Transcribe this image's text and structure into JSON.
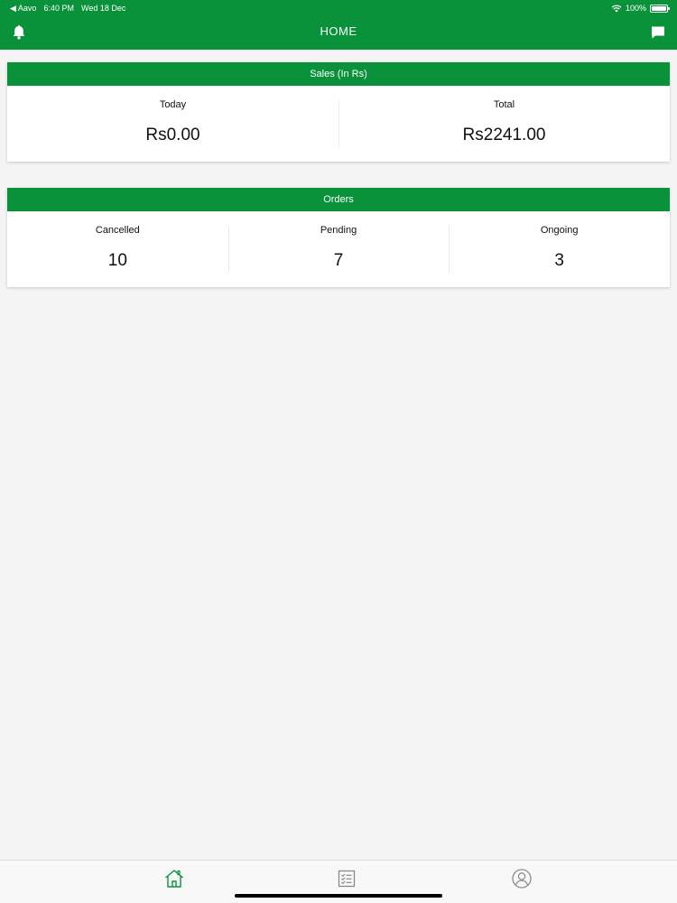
{
  "status_bar": {
    "back_label": "◀ Aavo",
    "time": "6:40 PM",
    "date": "Wed 18 Dec",
    "battery": "100%"
  },
  "nav": {
    "title": "HOME"
  },
  "sales": {
    "header": "Sales (In Rs)",
    "cells": [
      {
        "label": "Today",
        "value": "Rs0.00"
      },
      {
        "label": "Total",
        "value": "Rs2241.00"
      }
    ]
  },
  "orders": {
    "header": "Orders",
    "cells": [
      {
        "label": "Cancelled",
        "value": "10"
      },
      {
        "label": "Pending",
        "value": "7"
      },
      {
        "label": "Ongoing",
        "value": "3"
      }
    ]
  },
  "tabs": [
    {
      "icon": "home-icon",
      "active": true
    },
    {
      "icon": "checklist-icon",
      "active": false
    },
    {
      "icon": "profile-icon",
      "active": false
    }
  ],
  "colors": {
    "brand": "#0a923a",
    "background": "#f4f4f4",
    "tab_active": "#0a923a",
    "tab_inactive": "#8a8a8a"
  }
}
